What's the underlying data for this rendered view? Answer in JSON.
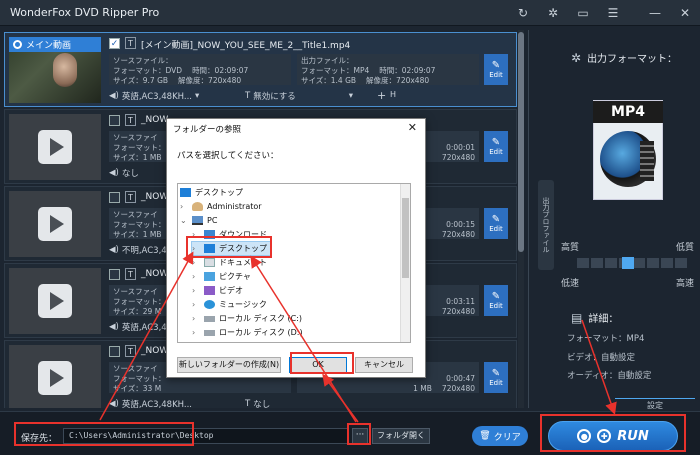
{
  "app": {
    "title": "WonderFox DVD Ripper Pro"
  },
  "titlebar_icons": [
    "refresh-icon",
    "gear-icon",
    "chat-icon",
    "menu-icon",
    "minimize-icon",
    "close-icon"
  ],
  "main_badge": "メイン動画",
  "items": [
    {
      "title": "[メイン動画]_NOW_YOU_SEE_ME_2__Title1.mp4",
      "src": {
        "label": "ソースファイル：",
        "format": "フォーマット：DVD",
        "time": "時間：02:09:07",
        "size": "サイズ：9.7 GB",
        "res": "解像度：720x480"
      },
      "out": {
        "label": "出力ファイル：",
        "format": "フォーマット：MP4",
        "time": "時間：02:09:07",
        "size": "サイズ：1.4 GB",
        "res": "解像度：720x480"
      },
      "audio": "英語,AC3,48KH...",
      "subtitle": "無効にする",
      "selected": true
    },
    {
      "title": "_NOW",
      "src": {
        "label": "ソースファイ",
        "format": "フォーマット：",
        "time": "",
        "size": "サイズ：1 MB",
        "res": ""
      },
      "out": {
        "label": "",
        "format": "",
        "time": "0:00:01",
        "size": "",
        "res": "720x480"
      },
      "audio": "なし",
      "subtitle": "",
      "selected": false
    },
    {
      "title": "_NOW",
      "src": {
        "label": "ソースファイ",
        "format": "フォーマット：",
        "time": "",
        "size": "サイズ：1 MB",
        "res": ""
      },
      "out": {
        "label": "",
        "format": "",
        "time": "0:00:15",
        "size": "",
        "res": "720x480"
      },
      "audio": "不明,AC3,48K...",
      "subtitle": "",
      "selected": false
    },
    {
      "title": "_NOW",
      "src": {
        "label": "ソースファイ",
        "format": "フォーマット：",
        "time": "",
        "size": "サイズ：29 M",
        "res": ""
      },
      "out": {
        "label": "",
        "format": "",
        "time": "0:03:11",
        "size": "",
        "res": "720x480"
      },
      "audio": "英語,AC3,48K...",
      "subtitle": "",
      "selected": false
    },
    {
      "title": "_NOW",
      "src": {
        "label": "ソースファイ",
        "format": "フォーマット：",
        "time": "",
        "size": "サイズ：33 M",
        "res": ""
      },
      "out": {
        "label": "",
        "format": "",
        "time": "0:00:47",
        "size": "1 MB",
        "res": "720x480"
      },
      "audio": "英語,AC3,48KH...",
      "subtitle": "なし",
      "selected": false
    }
  ],
  "edit_label": "Edit",
  "right_panel": {
    "output_format_label": "出力フォーマット：",
    "format_name": "MP4",
    "fold_label": "出力プロファイル",
    "quality_high": "高質",
    "quality_low": "低質",
    "speed_low": "低速",
    "speed_high": "高速",
    "details_label": "詳細：",
    "detail_format": "フォーマット：MP4",
    "detail_video": "ビデオ：自動設定",
    "detail_audio": "オーディオ：自動設定",
    "settings_label": "設定"
  },
  "bottom": {
    "save_label": "保存先：",
    "path": "C:\\Users\\Administrator\\Desktop",
    "browse_label": "···",
    "open_folder_label": "フォルダ開く",
    "clear_label": "クリア",
    "run_label": "RUN"
  },
  "dialog": {
    "title": "フォルダーの参照",
    "prompt": "パスを選択してください：",
    "nodes": [
      "デスクトップ",
      "Administrator",
      "PC",
      "ダウンロード",
      "デスクトップ",
      "ドキュメント",
      "ピクチャ",
      "ビデオ",
      "ミュージック",
      "ローカル ディスク (C:)",
      "ローカル ディスク (D:)"
    ],
    "new_folder_label": "新しいフォルダーの作成(N)",
    "ok_label": "OK",
    "cancel_label": "キャンセル"
  },
  "colors": {
    "accent": "#2f7fd6",
    "highlight": "#e8322c"
  }
}
